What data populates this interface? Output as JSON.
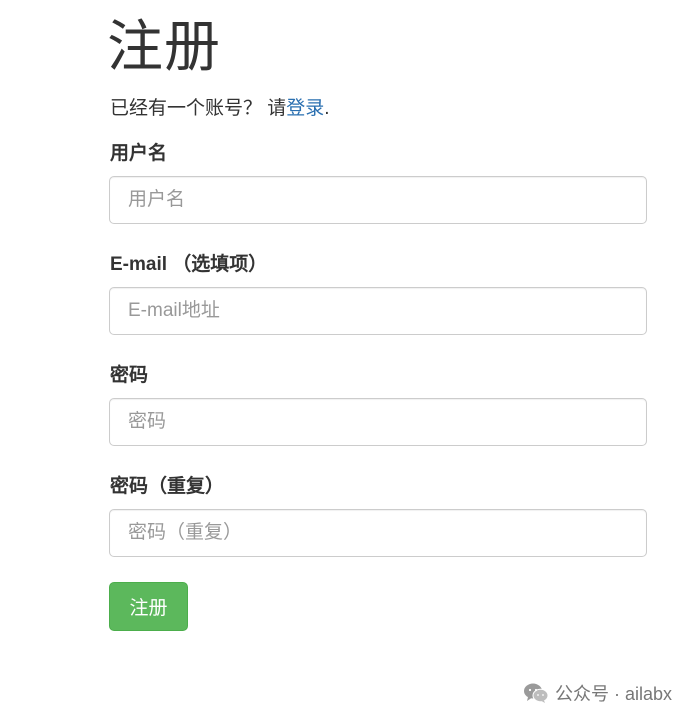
{
  "page": {
    "title": "注册"
  },
  "login_prompt": {
    "prefix": "已经有一个账号？ 请",
    "link": "登录",
    "suffix": "."
  },
  "form": {
    "username": {
      "label": "用户名",
      "placeholder": "用户名",
      "value": ""
    },
    "email": {
      "label": "E-mail （选填项）",
      "placeholder": "E-mail地址",
      "value": ""
    },
    "password": {
      "label": "密码",
      "placeholder": "密码",
      "value": ""
    },
    "password_repeat": {
      "label": "密码（重复）",
      "placeholder": "密码（重复）",
      "value": ""
    },
    "submit_label": "注册"
  },
  "watermark": {
    "icon": "wechat-icon",
    "text": "公众号 · ailabx"
  },
  "colors": {
    "link": "#2a6fb0",
    "submit_bg": "#5cb85c",
    "text": "#333333"
  }
}
